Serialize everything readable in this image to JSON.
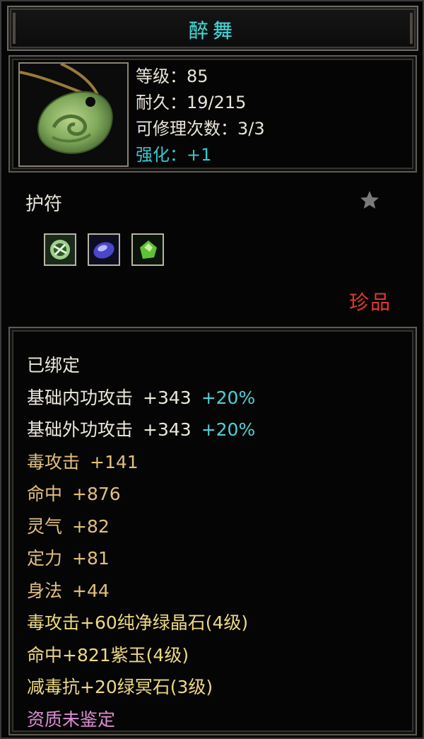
{
  "item": {
    "name": "醉舞",
    "level_label": "等级：85",
    "durability_label": "耐久：19/215",
    "repair_label": "可修理次数：3/3",
    "enhance_label": "强化：+1",
    "category": "护符",
    "rarity": "珍品",
    "icon": "jade-pendant-icon",
    "sockets": [
      {
        "icon": "green-crystal-gem-icon"
      },
      {
        "icon": "purple-jade-gem-icon"
      },
      {
        "icon": "green-dark-stone-gem-icon"
      }
    ]
  },
  "attributes": {
    "bound": "已绑定",
    "inner_attack": {
      "label": "基础内功攻击",
      "value": "+343",
      "bonus": "+20%"
    },
    "outer_attack": {
      "label": "基础外功攻击",
      "value": "+343",
      "bonus": "+20%"
    },
    "stats": [
      {
        "label": "毒攻击",
        "value": "+141"
      },
      {
        "label": "命中",
        "value": "+876"
      },
      {
        "label": "灵气",
        "value": "+82"
      },
      {
        "label": "定力",
        "value": "+81"
      },
      {
        "label": "身法",
        "value": "+44"
      }
    ],
    "gem_lines": [
      "毒攻击+60纯净绿晶石(4级)",
      "命中+821紫玉(4级)",
      "减毒抗+20绿冥石(3级)"
    ],
    "quality": "资质未鉴定"
  },
  "colors": {
    "title": "#4fd6d6",
    "enhance": "#37c8d0",
    "rarity": "#e03a2e",
    "stat": "#e1c07d",
    "gem_line": "#ecd983",
    "quality": "#dc8fd2"
  }
}
